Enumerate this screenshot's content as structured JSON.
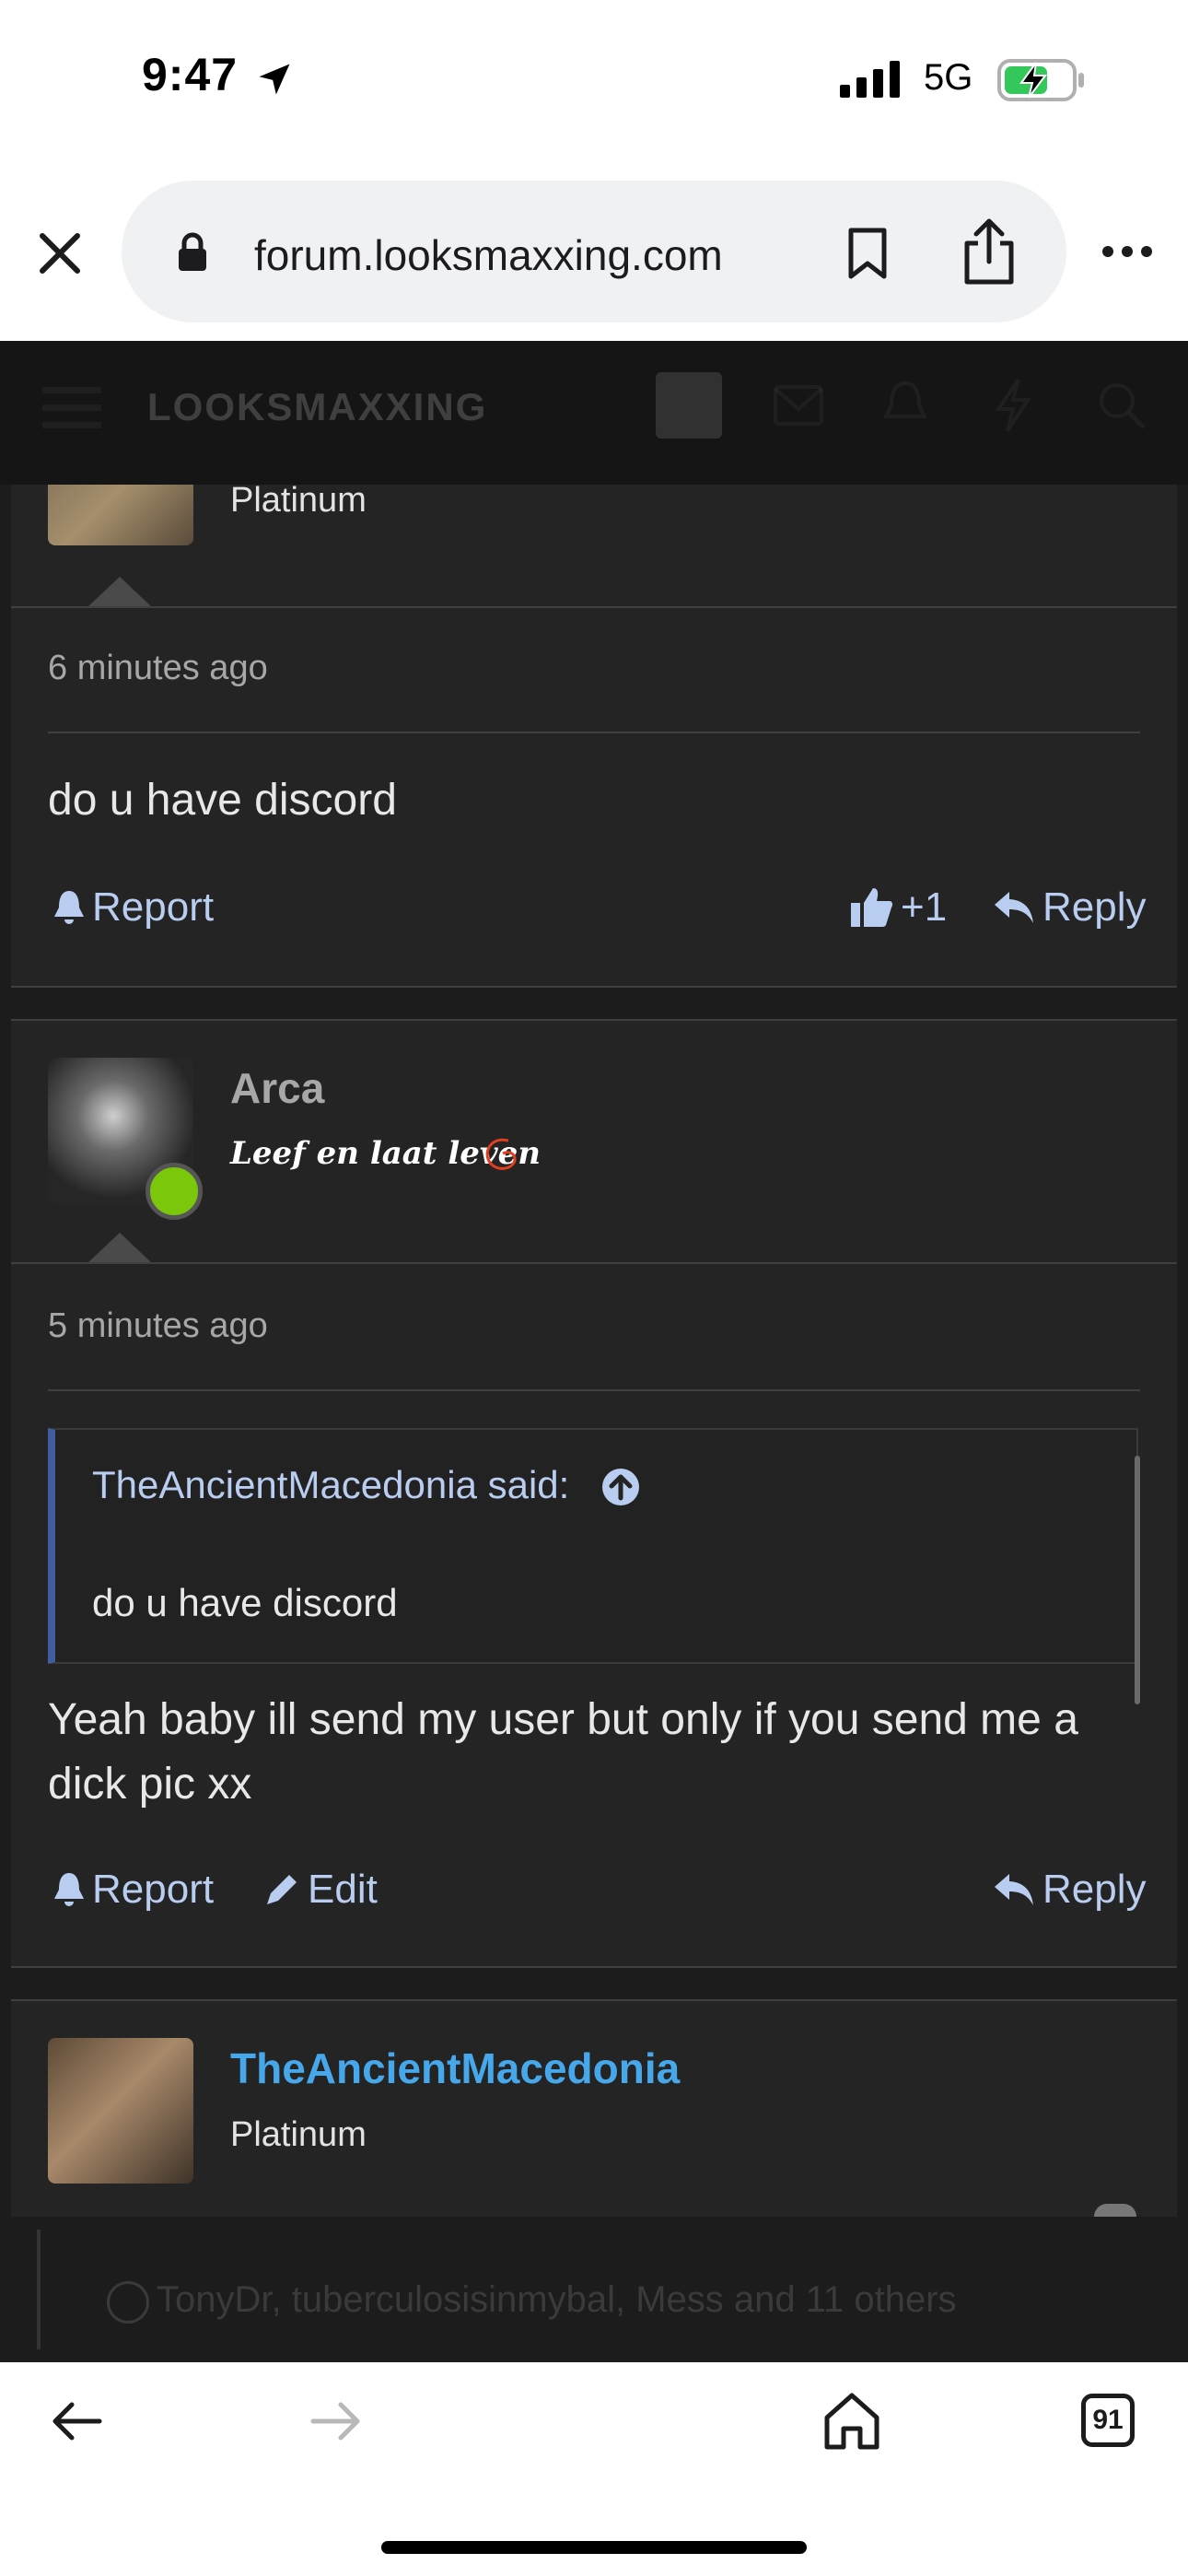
{
  "status_bar": {
    "time": "9:47",
    "network": "5G",
    "icons": [
      "location-arrow-icon",
      "signal-bars-icon",
      "battery-charging-icon"
    ]
  },
  "browser": {
    "url": "forum.looksmaxxing.com",
    "icons": [
      "close-icon",
      "lock-icon",
      "bookmark-icon",
      "share-icon",
      "more-icon"
    ],
    "tab_count": "91"
  },
  "site_header": {
    "logo": "LOOKSMAXXING",
    "icons": [
      "menu-icon",
      "avatar",
      "mail-icon",
      "bell-icon",
      "bolt-icon",
      "search-icon"
    ]
  },
  "posts": [
    {
      "user_title": "Platinum",
      "time_ago": "6 minutes ago",
      "body": "do u have discord",
      "actions": {
        "report": "Report",
        "reaction_count": "+1",
        "reply": "Reply"
      }
    },
    {
      "username": "Arca",
      "signature": "Leef en laat leven",
      "time_ago": "5 minutes ago",
      "quote": {
        "author": "TheAncientMacedonia said:",
        "text": "do u have discord"
      },
      "body": "Yeah baby ill send my user but only if you send me a dick pic xx",
      "actions": {
        "report": "Report",
        "edit": "Edit",
        "reply": "Reply"
      }
    },
    {
      "username": "TheAncientMacedonia",
      "user_title": "Platinum"
    }
  ],
  "reactions_bar": {
    "text": "TonyDr, tuberculosisinmybal, Mess and 11 others"
  },
  "colors": {
    "background": "#1c1c1c",
    "card": "#242424",
    "accent_link": "#b9cdf0",
    "username_blue": "#47a7eb",
    "online_green": "#7ac70c"
  }
}
